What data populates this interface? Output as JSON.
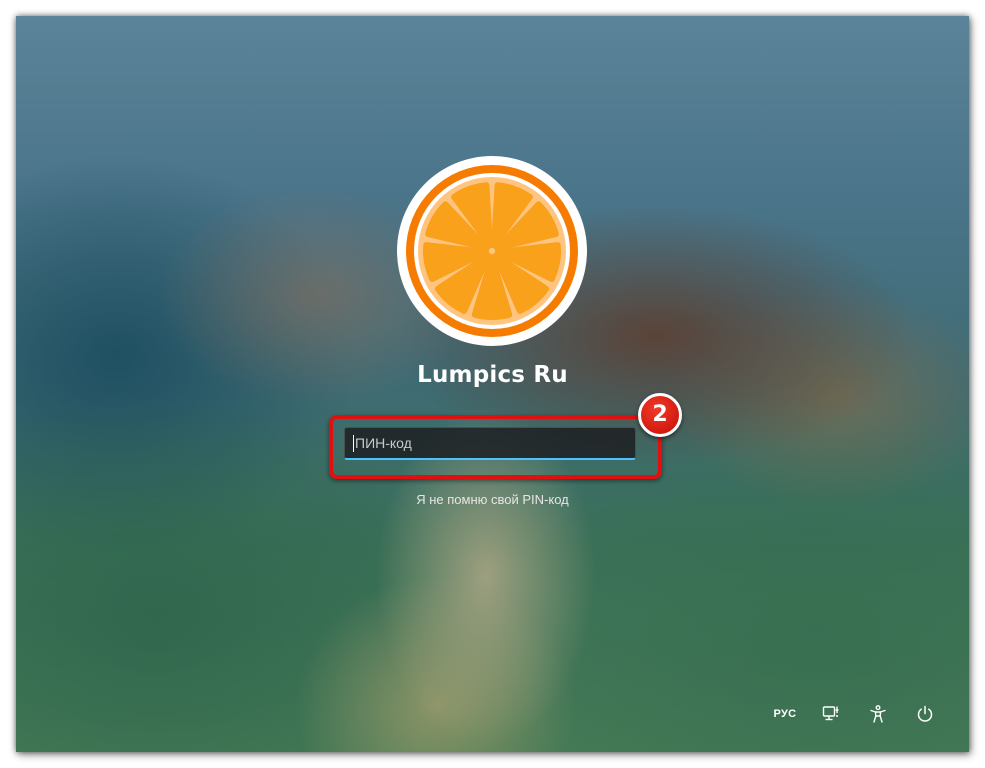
{
  "user": {
    "name": "Lumpics Ru",
    "avatar_icon": "orange-slice-icon"
  },
  "pin": {
    "value": "",
    "placeholder": "ПИН-код",
    "focus_color": "#4cc2ff"
  },
  "forgot_pin_link": "Я не помню свой PIN-код",
  "annotation": {
    "step_number": "2",
    "color": "#e01010"
  },
  "tray": {
    "language": "РУС",
    "icons": [
      "network-icon",
      "accessibility-icon",
      "power-icon"
    ]
  }
}
